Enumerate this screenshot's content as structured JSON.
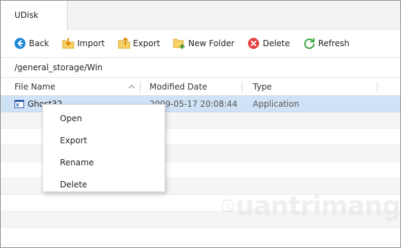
{
  "window": {
    "tab_title": "UDisk"
  },
  "toolbar": {
    "back_label": "Back",
    "import_label": "Import",
    "export_label": "Export",
    "new_folder_label": "New Folder",
    "delete_label": "Delete",
    "refresh_label": "Refresh"
  },
  "path": "/general_storage/Win",
  "columns": {
    "name": "File Name",
    "modified": "Modified Date",
    "type": "Type"
  },
  "files": [
    {
      "name": "Ghost32",
      "modified": "2009-05-17 20:08:44",
      "type": "Application",
      "selected": true
    }
  ],
  "context_menu": {
    "items": [
      "Open",
      "Export",
      "Rename",
      "Delete"
    ]
  },
  "watermark": {
    "text": "uantrimang"
  },
  "colors": {
    "selection": "#cfe2f6",
    "back_icon": "#1e88d6",
    "delete_icon": "#e2403e",
    "refresh_icon": "#3aa53a",
    "folder_icon": "#f2c23a"
  }
}
